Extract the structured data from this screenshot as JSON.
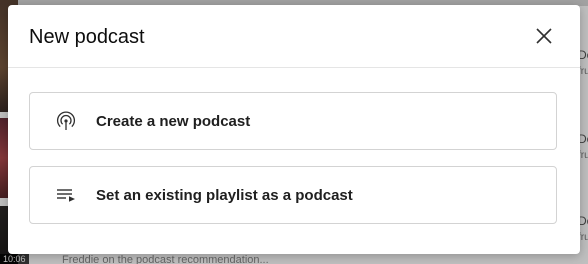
{
  "background": {
    "video_duration": "10:06",
    "bottom_caption": "Freddie on the podcast recommendation...",
    "right_snippets": [
      "Do",
      "fru",
      "Do",
      "fru",
      "Do",
      "fru"
    ]
  },
  "dialog": {
    "title": "New podcast",
    "close_icon": "close-icon",
    "options": [
      {
        "label": "Create a new podcast",
        "icon": "podcast-broadcast-icon"
      },
      {
        "label": "Set an existing playlist as a podcast",
        "icon": "playlist-play-icon"
      }
    ]
  },
  "colors": {
    "overlay": "rgba(0,0,0,0.25)",
    "dialog_bg": "#ffffff",
    "option_border": "#d3d3d3",
    "text_primary": "#0d0d0d"
  }
}
